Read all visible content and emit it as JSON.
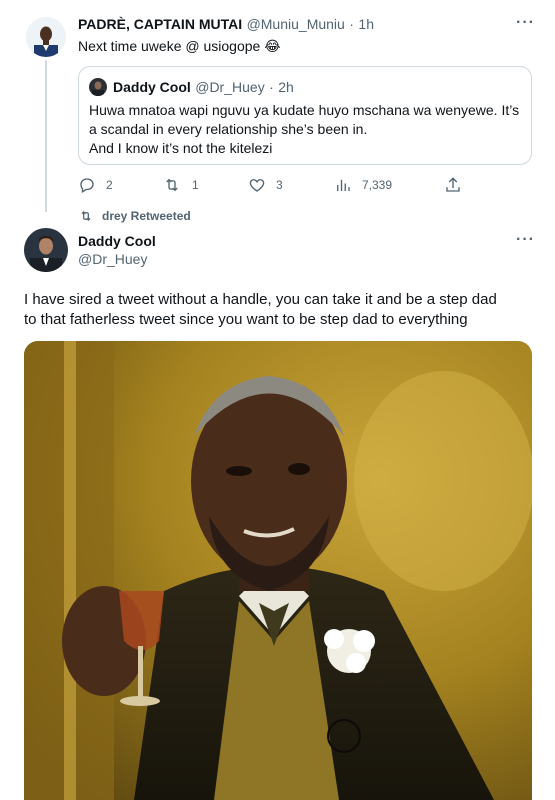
{
  "tweet1": {
    "author_name": "PADRÈ, CAPTAIN MUTAI",
    "author_handle": "@Muniu_Muniu",
    "separator": "·",
    "time": "1h",
    "text": "Next time uweke @ usiogope 😂",
    "quote": {
      "author_name": "Daddy Cool",
      "author_handle": "@Dr_Huey",
      "separator": "·",
      "time": "2h",
      "line1": "Huwa mnatoa wapi nguvu ya kudate huyo mschana wa wenyewe. It’s",
      "line2": "a scandal in every relationship she’s been in.",
      "line3": "And I know it’s not the kitelezi"
    },
    "actions": {
      "replies": "2",
      "retweets": "1",
      "likes": "3",
      "views": "7,339"
    }
  },
  "retweet_banner": "drey Retweeted",
  "tweet2": {
    "author_name": "Daddy Cool",
    "author_handle": "@Dr_Huey",
    "line1": "I have sired a tweet without a handle, you can take it and be a step dad",
    "line2": "to that fatherless tweet since you want to be step dad to everything"
  },
  "icons": {
    "more": "more-dots-icon",
    "reply": "reply-icon",
    "retweet": "retweet-icon",
    "like": "heart-icon",
    "views": "views-icon",
    "share": "share-icon"
  },
  "colors": {
    "text": "#0f1419",
    "secondary": "#536471",
    "border": "#cfd9de"
  }
}
